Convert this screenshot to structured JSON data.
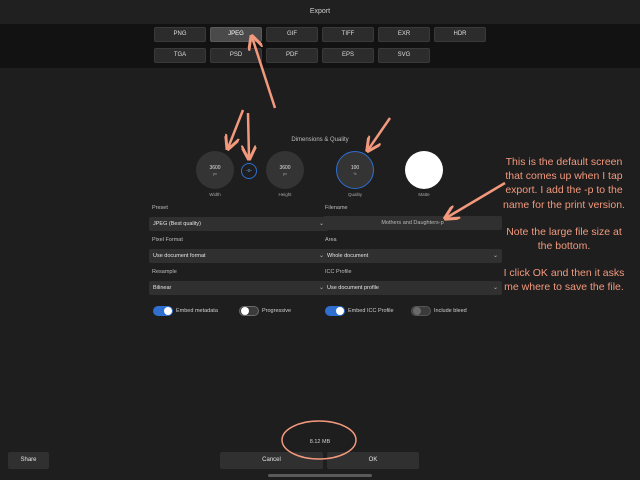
{
  "window": {
    "title": "Export"
  },
  "formats": {
    "row1": [
      "PNG",
      "JPEG",
      "GIF",
      "TIFF",
      "EXR",
      "HDR"
    ],
    "row2": [
      "TGA",
      "PSD",
      "PDF",
      "EPS",
      "SVG"
    ],
    "selected": "JPEG"
  },
  "dimensions": {
    "section_title": "Dimensions & Quality",
    "width": {
      "value": "3600",
      "unit": "px",
      "label": "Width"
    },
    "link_symbol": "-o-",
    "height": {
      "value": "3600",
      "unit": "px",
      "label": "Height"
    },
    "quality": {
      "value": "100",
      "unit": "%",
      "label": "Quality"
    },
    "matte": {
      "label": "Matte",
      "color": "#ffffff"
    }
  },
  "fields": {
    "preset": {
      "label": "Preset",
      "value": "JPEG (Best quality)"
    },
    "filename": {
      "label": "Filename",
      "value": "Mothers and Daughters-p"
    },
    "pixel_format": {
      "label": "Pixel Format",
      "value": "Use document format"
    },
    "area": {
      "label": "Area",
      "value": "Whole document"
    },
    "resample": {
      "label": "Resample",
      "value": "Bilinear"
    },
    "icc_profile": {
      "label": "ICC Profile",
      "value": "Use document profile"
    }
  },
  "toggles": {
    "embed_metadata": {
      "label": "Embed metadata",
      "on": true
    },
    "progressive": {
      "label": "Progressive",
      "on": false
    },
    "embed_icc": {
      "label": "Embed ICC Profile",
      "on": true
    },
    "include_bleed": {
      "label": "Include bleed",
      "on": false
    }
  },
  "annotation": {
    "paragraph1": "This is the default screen that comes up when I tap export. I add the -p to the name for the print version.",
    "paragraph2": "Note the large file size at the bottom.",
    "paragraph3": "I click OK and then it asks me where to save the file."
  },
  "footer": {
    "file_size": "8.12 MB",
    "share_label": "Share",
    "cancel_label": "Cancel",
    "ok_label": "OK"
  },
  "colors": {
    "accent": "#2f6fd0",
    "annotation": "#f2997d",
    "background": "#1e1e1e"
  },
  "icons": {
    "chevron": "chevron-down-icon",
    "link": "link-icon"
  }
}
